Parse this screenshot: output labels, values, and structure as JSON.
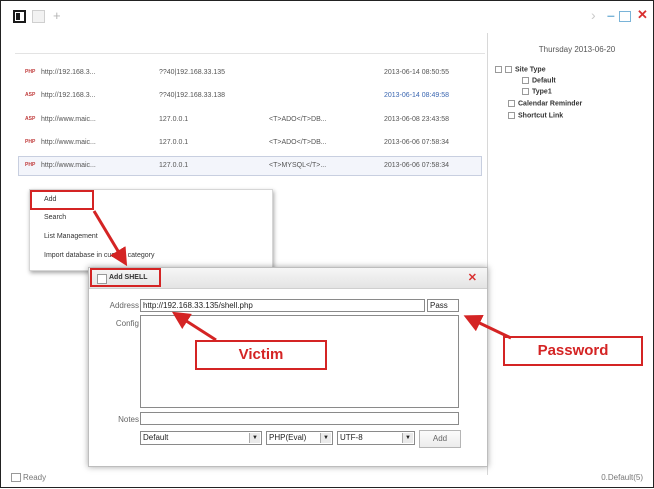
{
  "header": {
    "date": "Thursday 2013-06-20"
  },
  "list": {
    "rows": [
      {
        "type": "PHP",
        "url": "http://192.168.3...",
        "ip": "??40|192.168.33.135",
        "data": "",
        "time": "2013-06-14 08:50:55"
      },
      {
        "type": "ASP",
        "url": "http://192.168.3...",
        "ip": "??40|192.168.33.138",
        "data": "",
        "time": "2013-06-14 08:49:58"
      },
      {
        "type": "ASP",
        "url": "http://www.maic...",
        "ip": "127.0.0.1",
        "data": "<T>ADO</T>DB...",
        "time": "2013-06-08 23:43:58"
      },
      {
        "type": "PHP",
        "url": "http://www.maic...",
        "ip": "127.0.0.1",
        "data": "<T>ADO</T>DB...",
        "time": "2013-06-06 07:58:34"
      },
      {
        "type": "PHP",
        "url": "http://www.maic...",
        "ip": "127.0.0.1",
        "data": "<T>MYSQL</T>...",
        "time": "2013-06-06 07:58:34"
      }
    ]
  },
  "tree": {
    "items": [
      {
        "label": "Site Type"
      },
      {
        "label": "Default"
      },
      {
        "label": "Type1"
      },
      {
        "label": "Calendar Reminder"
      },
      {
        "label": "Shortcut Link"
      }
    ]
  },
  "context_menu": {
    "items": [
      {
        "label": "Add"
      },
      {
        "label": "Search"
      },
      {
        "label": "List Management"
      },
      {
        "label": "Import database in current category"
      }
    ]
  },
  "dialog": {
    "title": "Add SHELL",
    "address_label": "Address",
    "address_value": "http://192.168.33.135/shell.php",
    "pass_value": "Pass",
    "config_label": "Config",
    "notes_label": "Notes",
    "select_category": "Default",
    "select_script": "PHP(Eval)",
    "select_encoding": "UTF-8",
    "add_label": "Add"
  },
  "annotations": {
    "victim": "Victim",
    "password": "Password",
    "accent_color": "#d42424"
  },
  "status": {
    "left": "Ready",
    "right": "0.Default(5)"
  }
}
